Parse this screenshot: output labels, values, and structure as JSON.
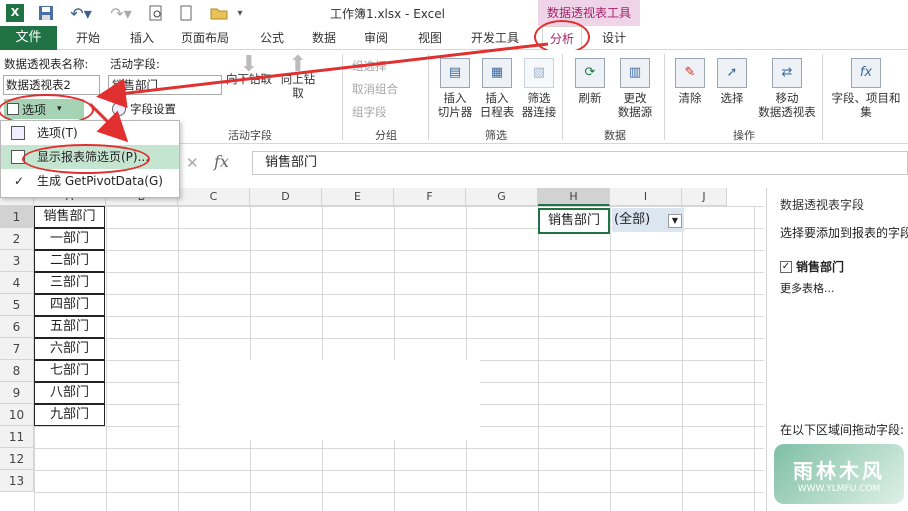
{
  "window": {
    "title": "工作簿1.xlsx - Excel",
    "context_tab_title": "数据透视表工具"
  },
  "quick_access": {
    "excel": "X",
    "save": "save-icon",
    "undo": "undo-icon",
    "redo": "redo-icon"
  },
  "tabs": [
    "文件",
    "开始",
    "插入",
    "页面布局",
    "公式",
    "数据",
    "审阅",
    "视图",
    "开发工具",
    "分析",
    "设计"
  ],
  "ribbon": {
    "pivot_name_label": "数据透视表名称:",
    "pivot_name_value": "数据透视表2",
    "options_button": "选项",
    "active_field_label": "活动字段:",
    "active_field_value": "销售部门",
    "field_settings": "字段设置",
    "drill_down": "向下钻取",
    "drill_up": "向上钻",
    "drill_up2": "取",
    "active_field_group": "活动字段",
    "group_selection": "组选择",
    "ungroup": "取消组合",
    "group_field": "组字段",
    "group_group": "分组",
    "insert_slicer": [
      "插入",
      "切片器"
    ],
    "insert_timeline": [
      "插入",
      "日程表"
    ],
    "filter_conn": [
      "筛选",
      "器连接"
    ],
    "filter_group": "筛选",
    "refresh": "刷新",
    "change_source": [
      "更改",
      "数据源"
    ],
    "data_group": "数据",
    "clear": "清除",
    "select": "选择",
    "move_pivot": [
      "移动",
      "数据透视表"
    ],
    "actions_group": "操作",
    "fields_items": [
      "字段、项目和",
      "集"
    ]
  },
  "dropdown": {
    "items": [
      "选项(T)",
      "显示报表筛选页(P)...",
      "生成 GetPivotData(G)"
    ]
  },
  "formula_bar": {
    "fx": "fx",
    "content": "销售部门",
    "cancel": "✕",
    "enter": "✓"
  },
  "columns": [
    "A",
    "B",
    "C",
    "D",
    "E",
    "F",
    "G",
    "H",
    "I",
    "J"
  ],
  "rows": [
    "1",
    "2",
    "3",
    "4",
    "5",
    "6",
    "7",
    "8",
    "9",
    "10",
    "11",
    "12",
    "13"
  ],
  "cells": {
    "A": [
      "销售部门",
      "一部门",
      "二部门",
      "三部门",
      "四部门",
      "五部门",
      "六部门",
      "七部门",
      "八部门",
      "九部门"
    ],
    "H1": "销售部门",
    "I1": "(全部)"
  },
  "field_panel": {
    "title": "数据透视表字段",
    "subtitle": "选择要添加到报表的字段",
    "field": "销售部门",
    "more": "更多表格...",
    "drag_hint": "在以下区域间拖动字段:"
  },
  "watermark": {
    "text": "雨林木风",
    "url": "WWW.YLMFU.COM"
  },
  "colors": {
    "excel_green": "#217346",
    "context_pink": "#a5226b",
    "annotation_red": "#e03030"
  }
}
